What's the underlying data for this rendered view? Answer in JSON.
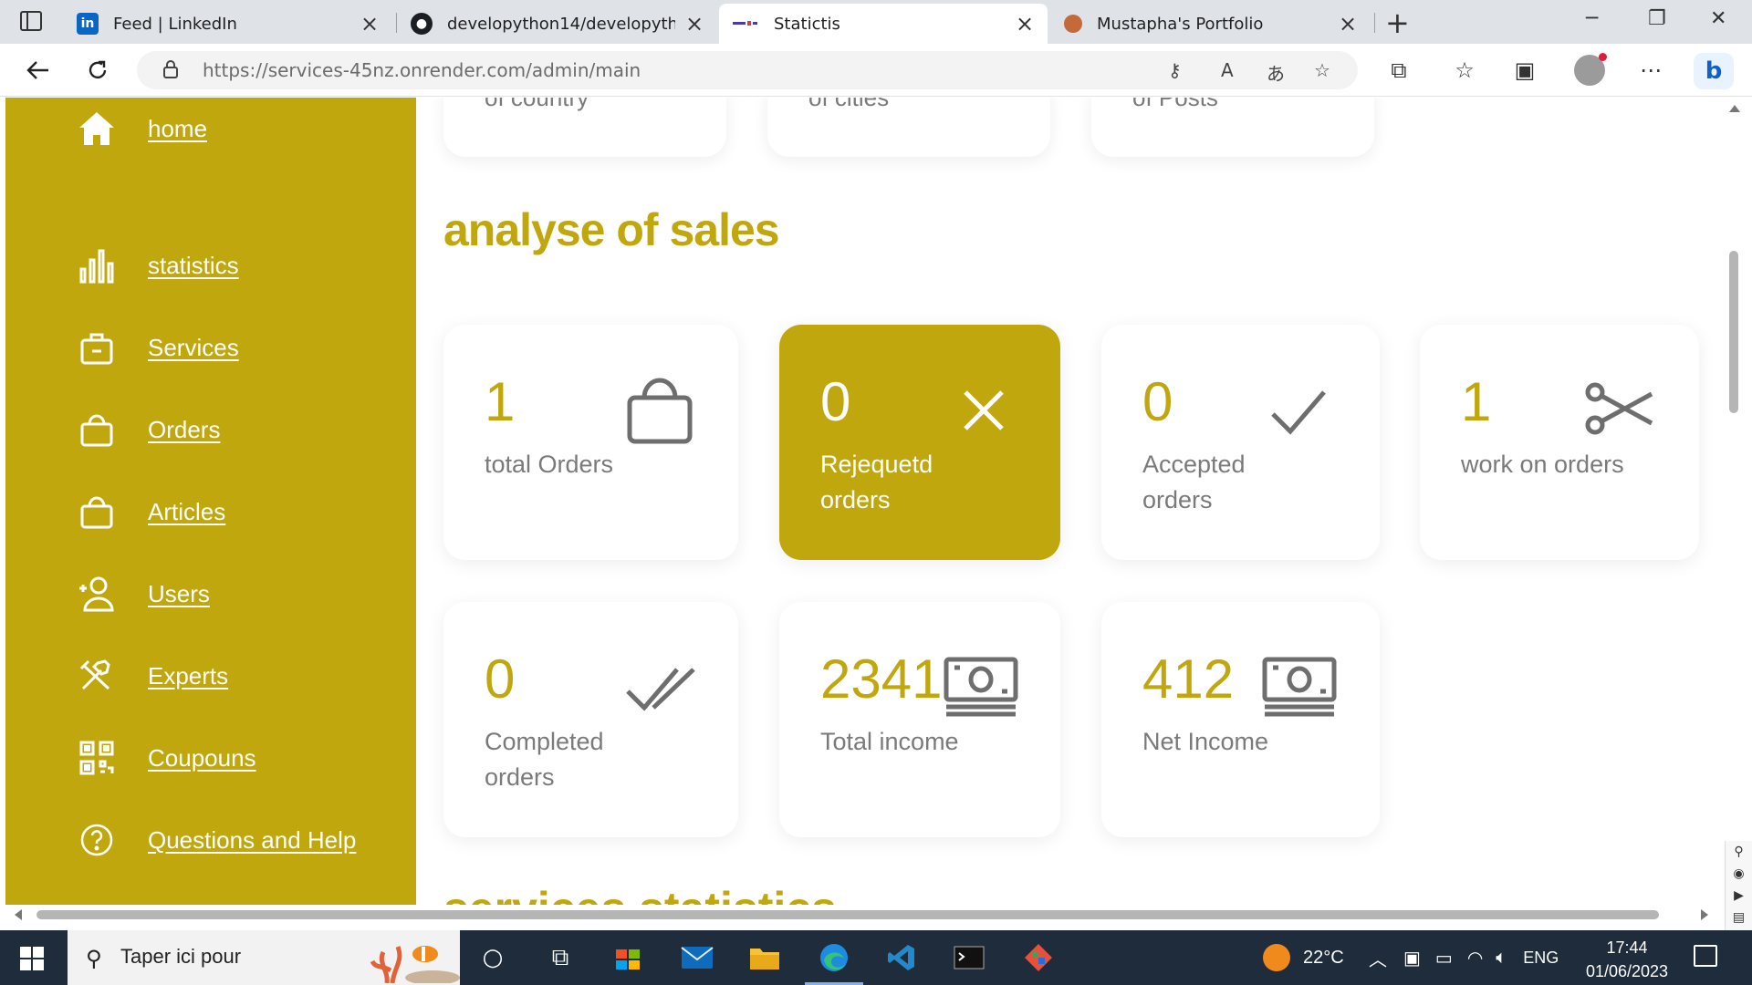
{
  "browser": {
    "tabs": [
      {
        "title": "Feed | LinkedIn",
        "favicon": "linkedin-icon",
        "active": false
      },
      {
        "title": "developython14/developython14",
        "favicon": "github-icon",
        "active": false
      },
      {
        "title": "Statictis",
        "favicon": "site-icon",
        "active": true
      },
      {
        "title": "Mustapha's Portfolio",
        "favicon": "portfolio-icon",
        "active": false
      }
    ],
    "url_host": "https://services-45nz.onrender.com",
    "url_path": "/admin/main"
  },
  "sidebar": {
    "color": "#c1a70e",
    "items": [
      {
        "label": "home",
        "icon": "home-icon"
      },
      {
        "label": "statistics",
        "icon": "bar-chart-icon"
      },
      {
        "label": "Services",
        "icon": "briefcase-icon"
      },
      {
        "label": "Orders",
        "icon": "shopping-bag-icon"
      },
      {
        "label": "Articles",
        "icon": "shopping-bag-icon"
      },
      {
        "label": "Users",
        "icon": "user-add-icon"
      },
      {
        "label": "Experts",
        "icon": "tools-icon"
      },
      {
        "label": "Coupouns",
        "icon": "qr-code-icon"
      },
      {
        "label": "Questions and Help",
        "icon": "help-circle-icon"
      }
    ]
  },
  "top_cards": [
    {
      "label": "of country"
    },
    {
      "label": "of cities"
    },
    {
      "label": "of Posts"
    }
  ],
  "sales": {
    "title": "analyse of sales",
    "cards": [
      {
        "value": "1",
        "label": "total Orders",
        "icon": "shopping-bag-icon",
        "highlighted": false
      },
      {
        "value": "0",
        "label": "Rejequetd orders",
        "icon": "close-icon",
        "highlighted": true
      },
      {
        "value": "0",
        "label": "Accepted orders",
        "icon": "check-icon",
        "highlighted": false
      },
      {
        "value": "1",
        "label": "work on orders",
        "icon": "scissors-icon",
        "highlighted": false
      },
      {
        "value": "0",
        "label": "Completed orders",
        "icon": "double-check-icon",
        "highlighted": false
      },
      {
        "value": "2341",
        "label": "Total income",
        "icon": "money-icon",
        "highlighted": false
      },
      {
        "value": "412",
        "label": "Net Income",
        "icon": "money-icon",
        "highlighted": false
      }
    ]
  },
  "next_section": {
    "title": "services statistics"
  },
  "taskbar": {
    "search_text": "Taper ici pour",
    "weather": "22°C",
    "language": "ENG",
    "time": "17:44",
    "date": "01/06/2023"
  }
}
